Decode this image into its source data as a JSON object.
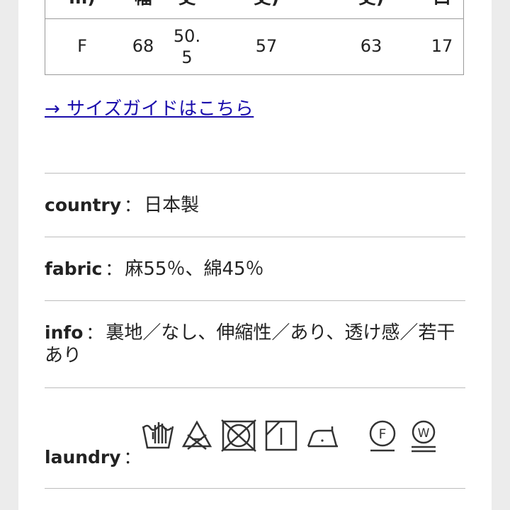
{
  "size_table": {
    "headers": [
      "m)",
      "幅",
      "丈",
      "丈)",
      "丈)",
      "口"
    ],
    "row": [
      "F",
      "68",
      "50.\n5",
      "57",
      "63",
      "17"
    ]
  },
  "size_guide_link": "→ サイズガイドはこちら",
  "specs": {
    "country": {
      "key": "country",
      "sep": "：",
      "value": "日本製"
    },
    "fabric": {
      "key": "fabric",
      "sep": "：",
      "value": "麻55％、綿45％"
    },
    "info": {
      "key": "info",
      "sep": "：",
      "value": "裏地／なし、伸縮性／あり、透け感／若干あり"
    },
    "laundry": {
      "key": "laundry",
      "sep": "："
    }
  },
  "laundry_icons": [
    "hand-wash-icon",
    "no-bleach-icon",
    "no-tumble-dry-icon",
    "line-dry-shade-icon",
    "iron-low-icon",
    "dry-clean-f-icon",
    "wet-clean-w-icon"
  ],
  "laundry_icon_letters": {
    "dry_clean": "F",
    "wet_clean": "W"
  },
  "colors": {
    "link": "#1a0dab",
    "divider": "#bdbdbd",
    "text": "#222222",
    "background": "#ececec"
  }
}
